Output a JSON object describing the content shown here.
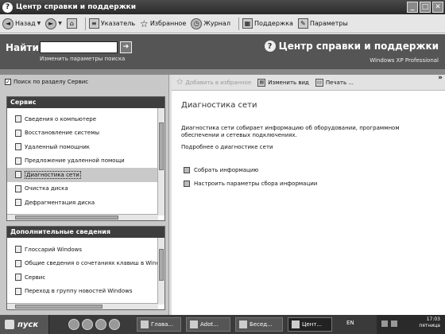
{
  "window": {
    "title": "Центр справки и поддержки",
    "buttons": {
      "minimize": "_",
      "maximize": "□",
      "close": "✕"
    }
  },
  "toolbar": {
    "back": "Назад",
    "index": "Указатель",
    "favorites": "Избранное",
    "history": "Журнал",
    "support": "Поддержка",
    "options": "Параметры"
  },
  "header": {
    "find_label": "Найти",
    "find_value": "",
    "find_go": "➔",
    "find_options": "Изменить параметры поиска",
    "title": "Центр справки и поддержки",
    "subtitle": "Windows XP Professional"
  },
  "left": {
    "search_prev_label": "Поиск по разделу Сервис",
    "box1": {
      "title": "Сервис",
      "items": [
        "Сведения о компьютере",
        "Восстановление системы",
        "Удаленный помощник",
        "Предложение удаленной помощи",
        "Диагностика сети",
        "Очистка диска",
        "Дефрагментация диска"
      ],
      "selected_index": 4
    },
    "box2": {
      "title": "Дополнительные сведения",
      "items": [
        "Глоссарий Windows",
        "Общие сведения о сочетаниях клавиш в Windows",
        "Сервис",
        "Переход в группу новостей Windows"
      ]
    }
  },
  "right": {
    "toolbar": {
      "add_fav": "Добавить в избранное",
      "change_view": "Изменить вид",
      "print": "Печать ...",
      "chevron": "»"
    },
    "title": "Диагностика сети",
    "description": "Диагностика сети собирает информацию об оборудовании, программном обеспечении и сетевых подключениях.",
    "more": "Подробнее о диагностике сети",
    "actions": [
      "Собрать информацию",
      "Настроить параметры сбора информации"
    ]
  },
  "taskbar": {
    "start": "пуск",
    "tasks": [
      "Глава...",
      "Adot...",
      "Бесед...",
      "Цент..."
    ],
    "active_task_index": 3,
    "lang": "EN",
    "time": "17:03",
    "day": "пятница"
  }
}
